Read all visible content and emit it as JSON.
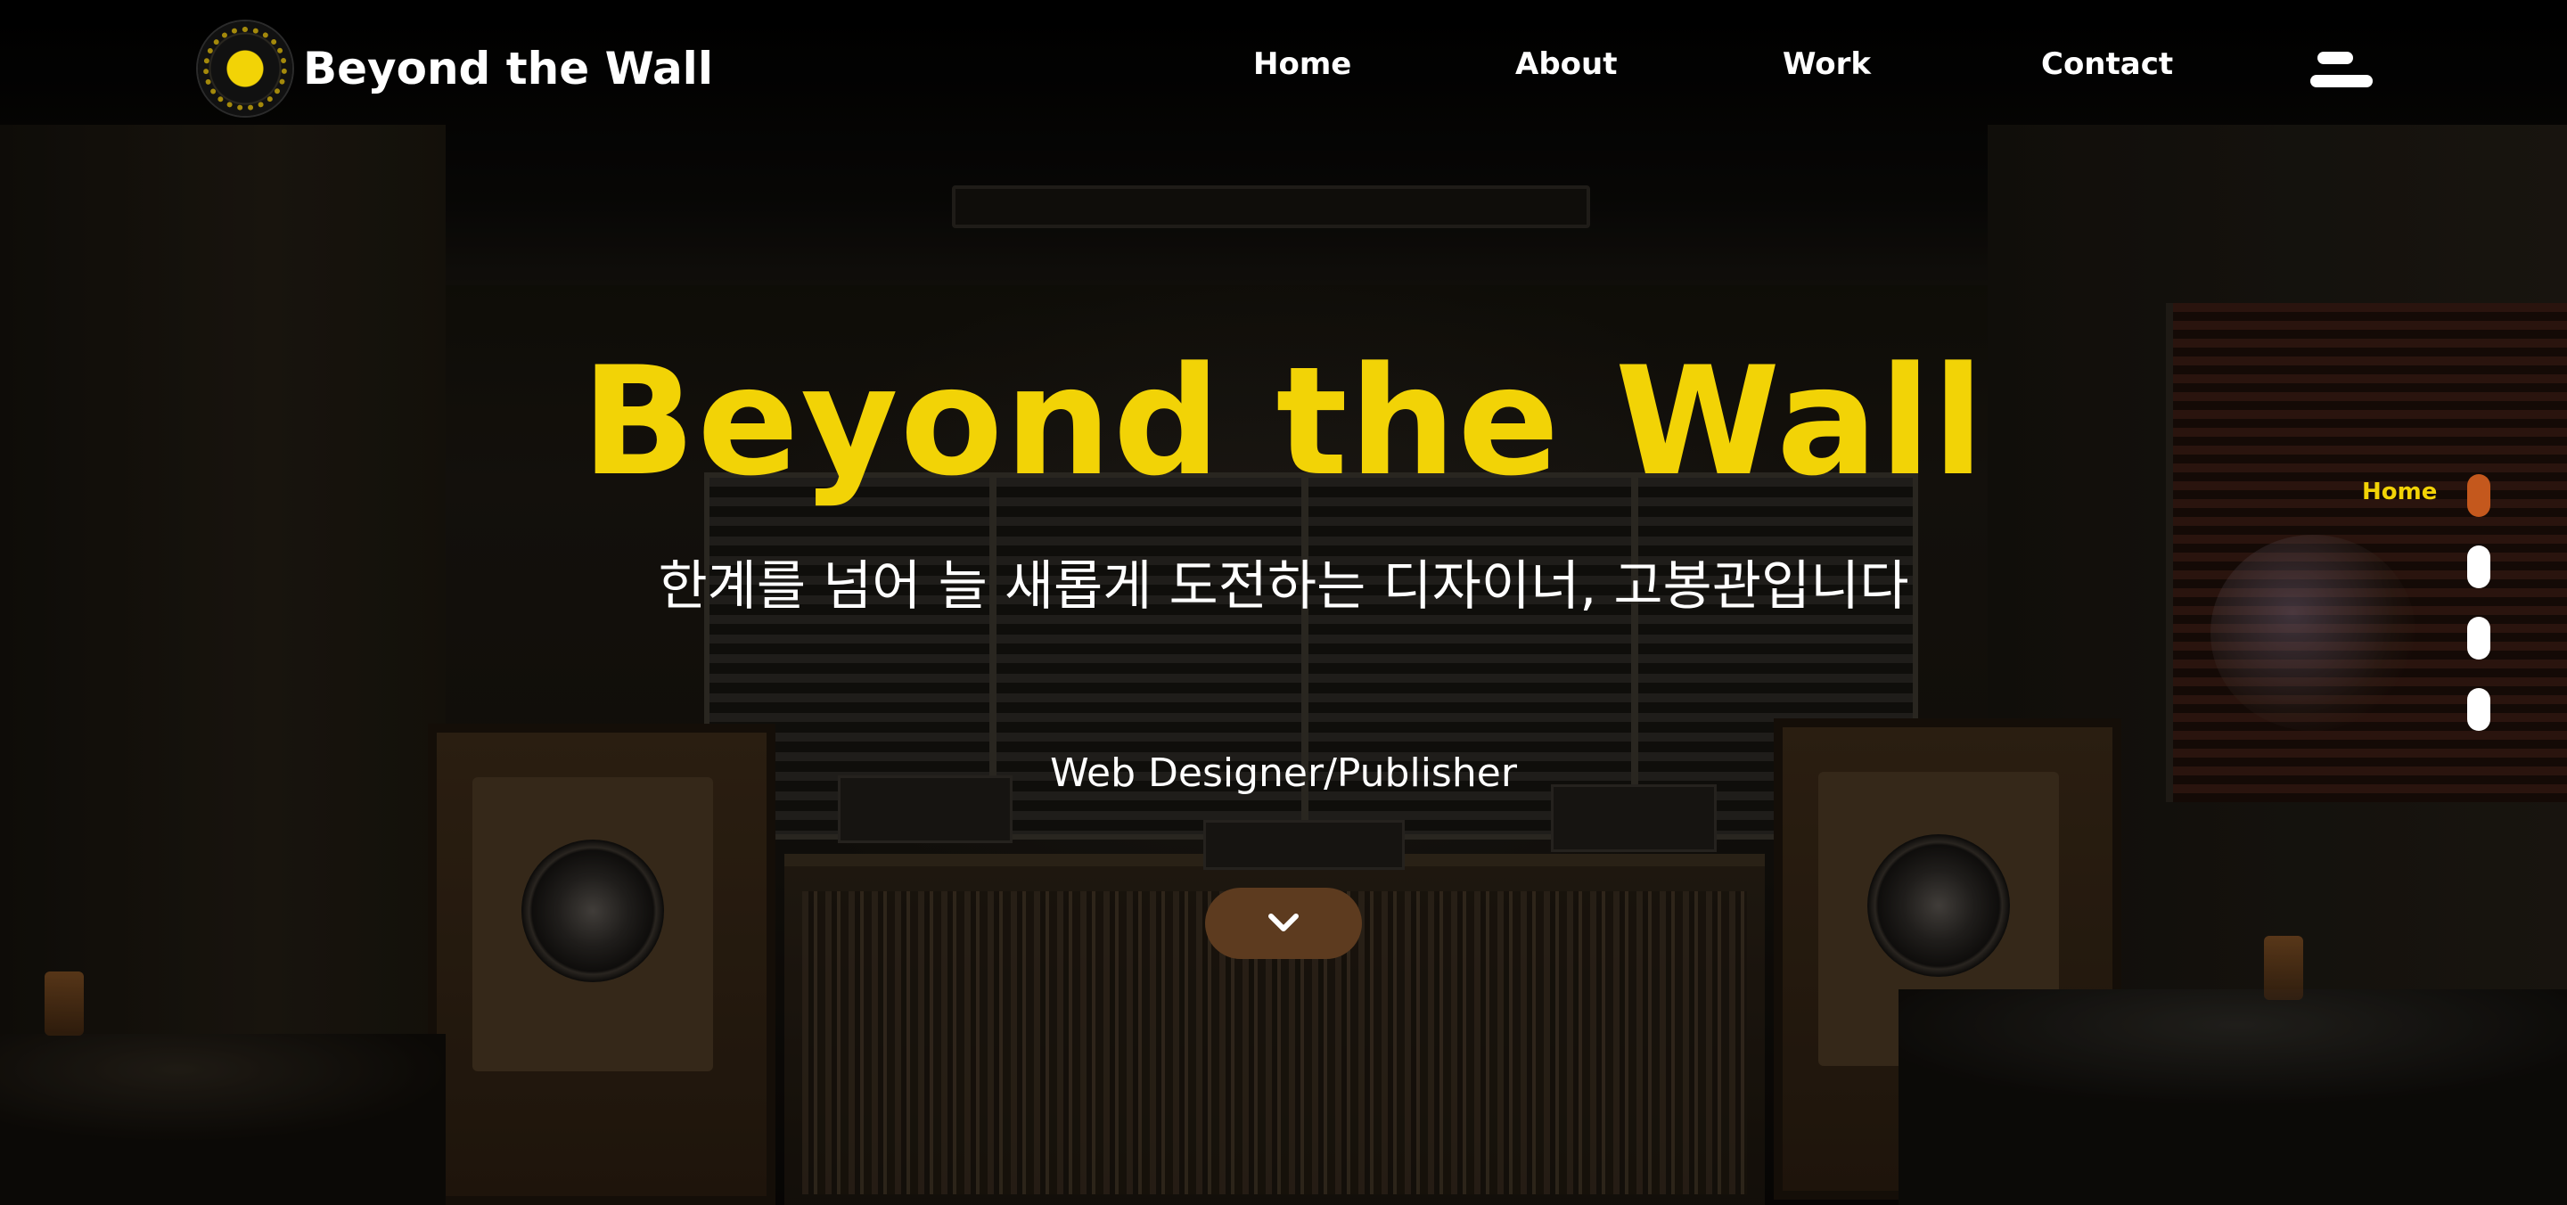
{
  "header": {
    "logo_text": "Beyond the Wall",
    "nav": [
      "Home",
      "About",
      "Work",
      "Contact"
    ]
  },
  "hero": {
    "title": "Beyond the Wall",
    "subtitle": "한계를 넘어 늘 새롭게 도전하는 디자이너, 고봉관입니다",
    "role": "Web Designer/Publisher"
  },
  "pager": {
    "active_label": "Home",
    "sections": 4,
    "active_index": 0
  },
  "colors": {
    "accent_yellow": "#f2d306",
    "active_dot": "#c4581d",
    "scroll_button": "#5d3b1f",
    "text": "#ffffff"
  },
  "icons": {
    "menu": "hamburger-menu-icon",
    "scroll": "chevron-down-icon",
    "logo": "vinyl-record-icon"
  }
}
